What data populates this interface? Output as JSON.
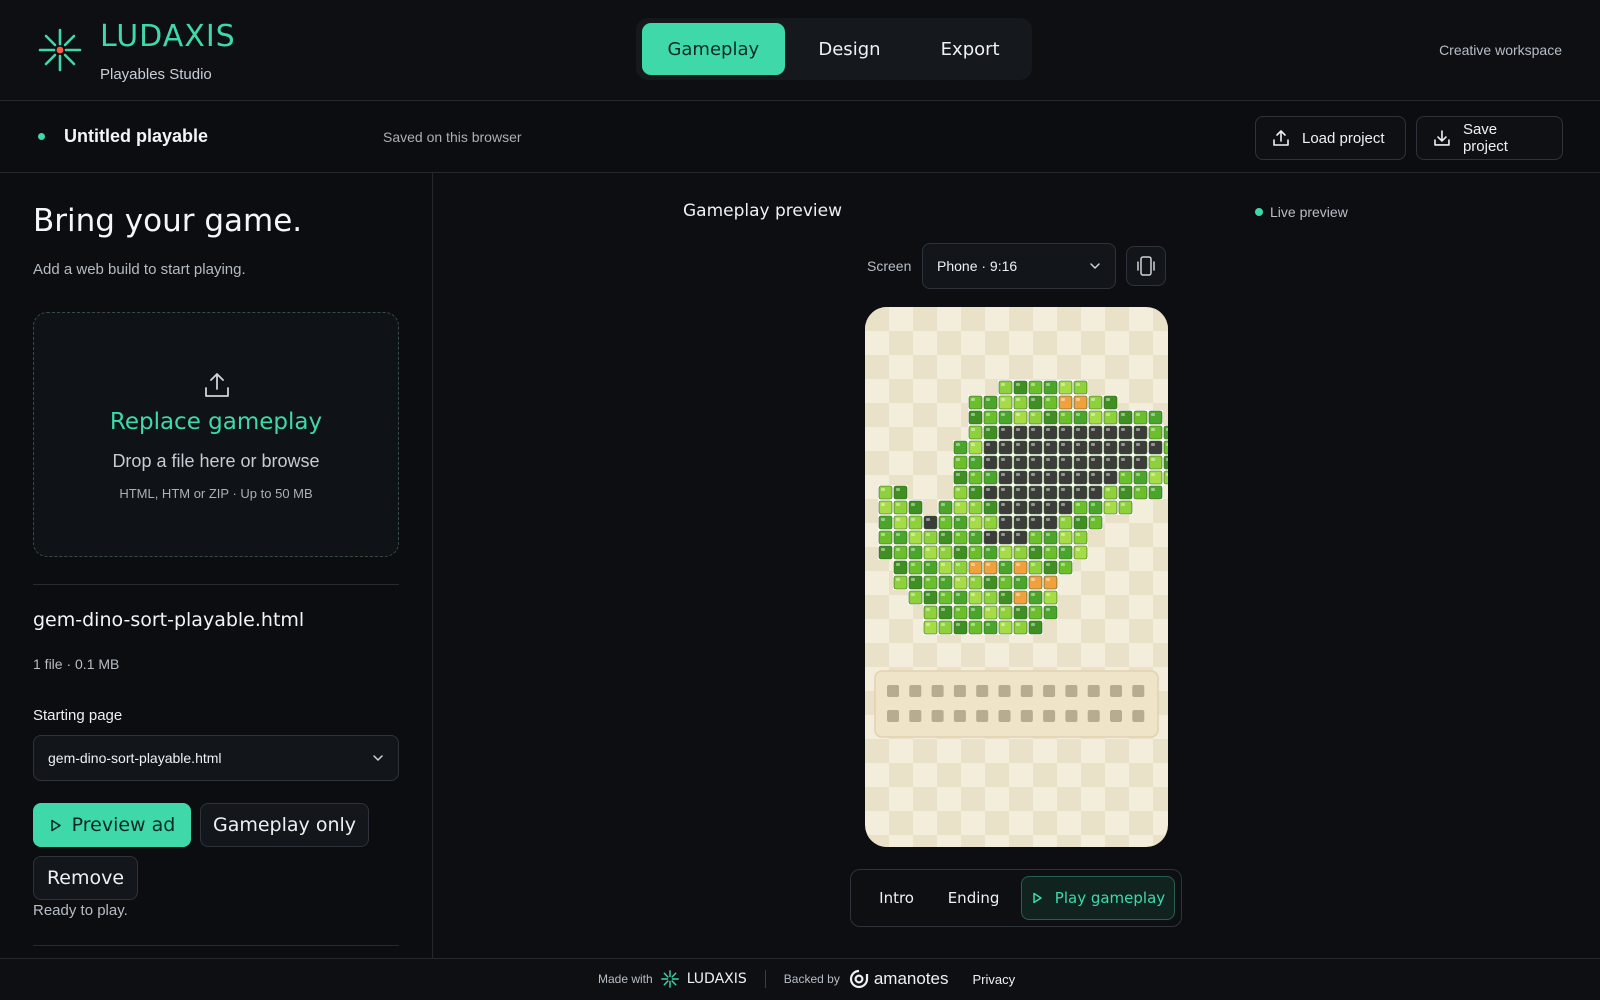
{
  "brand": {
    "name": "LUDAXIS",
    "subtitle": "Playables Studio",
    "accent": "#3fd9a9"
  },
  "mode_tabs": [
    {
      "label": "Gameplay",
      "active": true
    },
    {
      "label": "Design",
      "active": false
    },
    {
      "label": "Export",
      "active": false
    }
  ],
  "workspace_label": "Creative workspace",
  "project": {
    "title": "Untitled playable",
    "saved_status": "Saved on this browser",
    "load_label": "Load project",
    "save_label": "Save project"
  },
  "left_panel": {
    "title": "Bring your game.",
    "subtitle": "Add a web build to start playing.",
    "dropzone": {
      "title": "Replace gameplay",
      "line": "Drop a file here or browse",
      "hint": "HTML, HTM or ZIP · Up to 50 MB",
      "icon": "upload-icon"
    },
    "file": {
      "name": "gem-dino-sort-playable.html",
      "meta": "1 file · 0.1 MB"
    },
    "starting_page": {
      "label": "Starting page",
      "value": "gem-dino-sort-playable.html"
    },
    "buttons": {
      "preview": "Preview ad",
      "gameplay_only": "Gameplay only",
      "remove": "Remove"
    },
    "status": "Ready to play."
  },
  "preview": {
    "title": "Gameplay preview",
    "live_label": "Live preview",
    "screen_label": "Screen",
    "screen_value": "Phone · 9:16",
    "scene_tabs": [
      {
        "label": "Intro",
        "active": false
      },
      {
        "label": "Ending",
        "active": false
      },
      {
        "label": "Play gameplay",
        "active": true
      }
    ]
  },
  "footer": {
    "made_with": "Made with",
    "brand": "LUDAXIS",
    "backed_by": "Backed by",
    "partner": "amanotes",
    "privacy": "Privacy"
  }
}
